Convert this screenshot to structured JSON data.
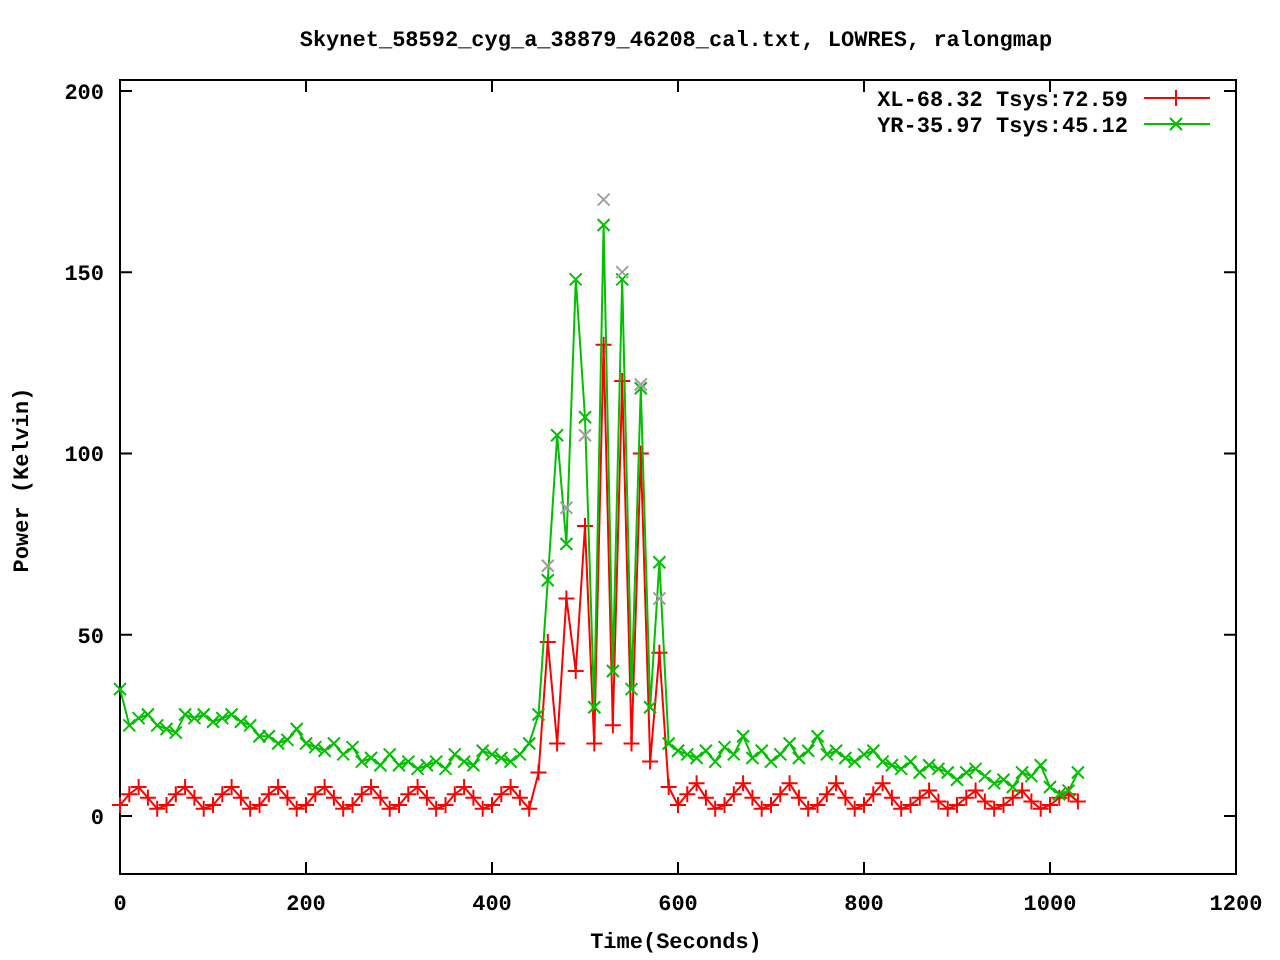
{
  "chart_data": {
    "type": "line",
    "title": "Skynet_58592_cyg_a_38879_46208_cal.txt, LOWRES, ralongmap",
    "xlabel": "Time(Seconds)",
    "ylabel": "Power (Kelvin)",
    "xlim": [
      0,
      1200
    ],
    "ylim": [
      -16,
      203
    ],
    "xticks": [
      0,
      200,
      400,
      600,
      800,
      1000,
      1200
    ],
    "yticks": [
      0,
      50,
      100,
      150,
      200
    ],
    "legend": true,
    "x": [
      0,
      10,
      20,
      30,
      40,
      50,
      60,
      70,
      80,
      90,
      100,
      110,
      120,
      130,
      140,
      150,
      160,
      170,
      180,
      190,
      200,
      210,
      220,
      230,
      240,
      250,
      260,
      270,
      280,
      290,
      300,
      310,
      320,
      330,
      340,
      350,
      360,
      370,
      380,
      390,
      400,
      410,
      420,
      430,
      440,
      450,
      460,
      470,
      480,
      490,
      500,
      510,
      520,
      530,
      540,
      550,
      560,
      570,
      580,
      590,
      600,
      610,
      620,
      630,
      640,
      650,
      660,
      670,
      680,
      690,
      700,
      710,
      720,
      730,
      740,
      750,
      760,
      770,
      780,
      790,
      800,
      810,
      820,
      830,
      840,
      850,
      860,
      870,
      880,
      890,
      900,
      910,
      920,
      930,
      940,
      950,
      960,
      970,
      980,
      990,
      1000,
      1010,
      1020,
      1030
    ],
    "series": [
      {
        "name": "XL-68.32 Tsys:72.59",
        "color": "#ff0000",
        "marker": "plus",
        "values": [
          3,
          6,
          8,
          5,
          2,
          3,
          6,
          8,
          5,
          2,
          3,
          6,
          8,
          5,
          2,
          3,
          6,
          8,
          5,
          2,
          3,
          6,
          8,
          5,
          2,
          3,
          6,
          8,
          5,
          2,
          3,
          6,
          8,
          5,
          2,
          3,
          6,
          8,
          5,
          2,
          3,
          6,
          8,
          5,
          2,
          12,
          48,
          20,
          60,
          40,
          80,
          20,
          130,
          25,
          120,
          20,
          100,
          15,
          45,
          8,
          3,
          6,
          9,
          5,
          2,
          3,
          6,
          9,
          5,
          2,
          3,
          6,
          9,
          5,
          2,
          3,
          6,
          9,
          5,
          2,
          3,
          6,
          9,
          5,
          2,
          3,
          5,
          7,
          4,
          2,
          3,
          5,
          7,
          4,
          2,
          3,
          5,
          7,
          4,
          2,
          3,
          5,
          6,
          4
        ]
      },
      {
        "name": "YR-35.97 Tsys:45.12",
        "color": "#00c000",
        "marker": "cross",
        "values": [
          35,
          25,
          27,
          28,
          25,
          24,
          23,
          28,
          27,
          28,
          26,
          27,
          28,
          26,
          25,
          22,
          22,
          20,
          21,
          24,
          20,
          19,
          18,
          20,
          17,
          19,
          15,
          16,
          14,
          17,
          14,
          15,
          13,
          14,
          15,
          13,
          17,
          15,
          14,
          18,
          17,
          16,
          15,
          17,
          20,
          28,
          65,
          105,
          75,
          148,
          110,
          30,
          163,
          40,
          148,
          35,
          118,
          30,
          70,
          20,
          18,
          17,
          16,
          18,
          15,
          19,
          17,
          22,
          16,
          18,
          15,
          17,
          20,
          16,
          18,
          22,
          17,
          18,
          16,
          15,
          17,
          18,
          15,
          14,
          13,
          15,
          12,
          14,
          13,
          12,
          10,
          12,
          13,
          11,
          9,
          10,
          8,
          12,
          11,
          14,
          8,
          6,
          7,
          12
        ]
      },
      {
        "color": "#a0a0a0",
        "marker": "cross",
        "values": [
          null,
          null,
          null,
          null,
          null,
          null,
          null,
          null,
          null,
          null,
          null,
          null,
          null,
          null,
          null,
          null,
          null,
          null,
          null,
          null,
          null,
          null,
          null,
          null,
          null,
          null,
          null,
          null,
          null,
          null,
          null,
          null,
          null,
          null,
          null,
          null,
          null,
          null,
          null,
          null,
          null,
          null,
          null,
          null,
          null,
          null,
          69,
          null,
          85,
          null,
          105,
          null,
          170,
          null,
          150,
          null,
          119,
          null,
          60,
          null,
          null,
          null,
          null,
          null,
          null,
          null,
          null,
          null,
          null,
          null,
          null,
          null,
          null,
          null,
          null,
          null,
          null,
          null,
          null,
          null,
          null,
          null,
          null,
          null,
          null,
          null,
          null,
          null,
          null,
          null,
          null,
          null,
          null,
          null,
          null,
          null,
          null,
          null,
          null,
          null,
          null,
          null,
          null,
          null
        ]
      }
    ]
  }
}
